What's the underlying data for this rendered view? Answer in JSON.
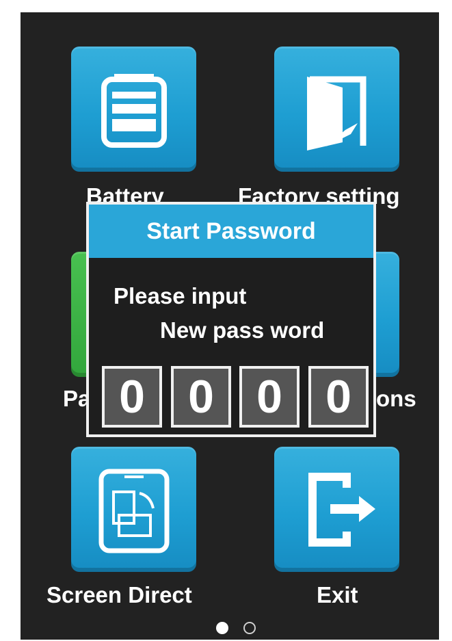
{
  "tiles": [
    {
      "label": "Battery",
      "icon": "battery-icon"
    },
    {
      "label": "Factory setting",
      "icon": "door-icon"
    },
    {
      "label": "Pa",
      "icon": "password-icon"
    },
    {
      "label": "ons",
      "icon": "options-icon"
    },
    {
      "label": "Screen Direct",
      "icon": "screen-rotate-icon"
    },
    {
      "label": "Exit",
      "icon": "exit-icon"
    }
  ],
  "dialog": {
    "title": "Start Password",
    "line1": "Please input",
    "line2": "New pass word",
    "digits": [
      "0",
      "0",
      "0",
      "0"
    ]
  },
  "pager": {
    "count": 2,
    "active": 0
  },
  "colors": {
    "background": "#222222",
    "tile_blue": "#1e9ed2",
    "tile_green": "#32a63c",
    "dialog_header": "#2aa6d8",
    "digit_box": "#555555"
  }
}
